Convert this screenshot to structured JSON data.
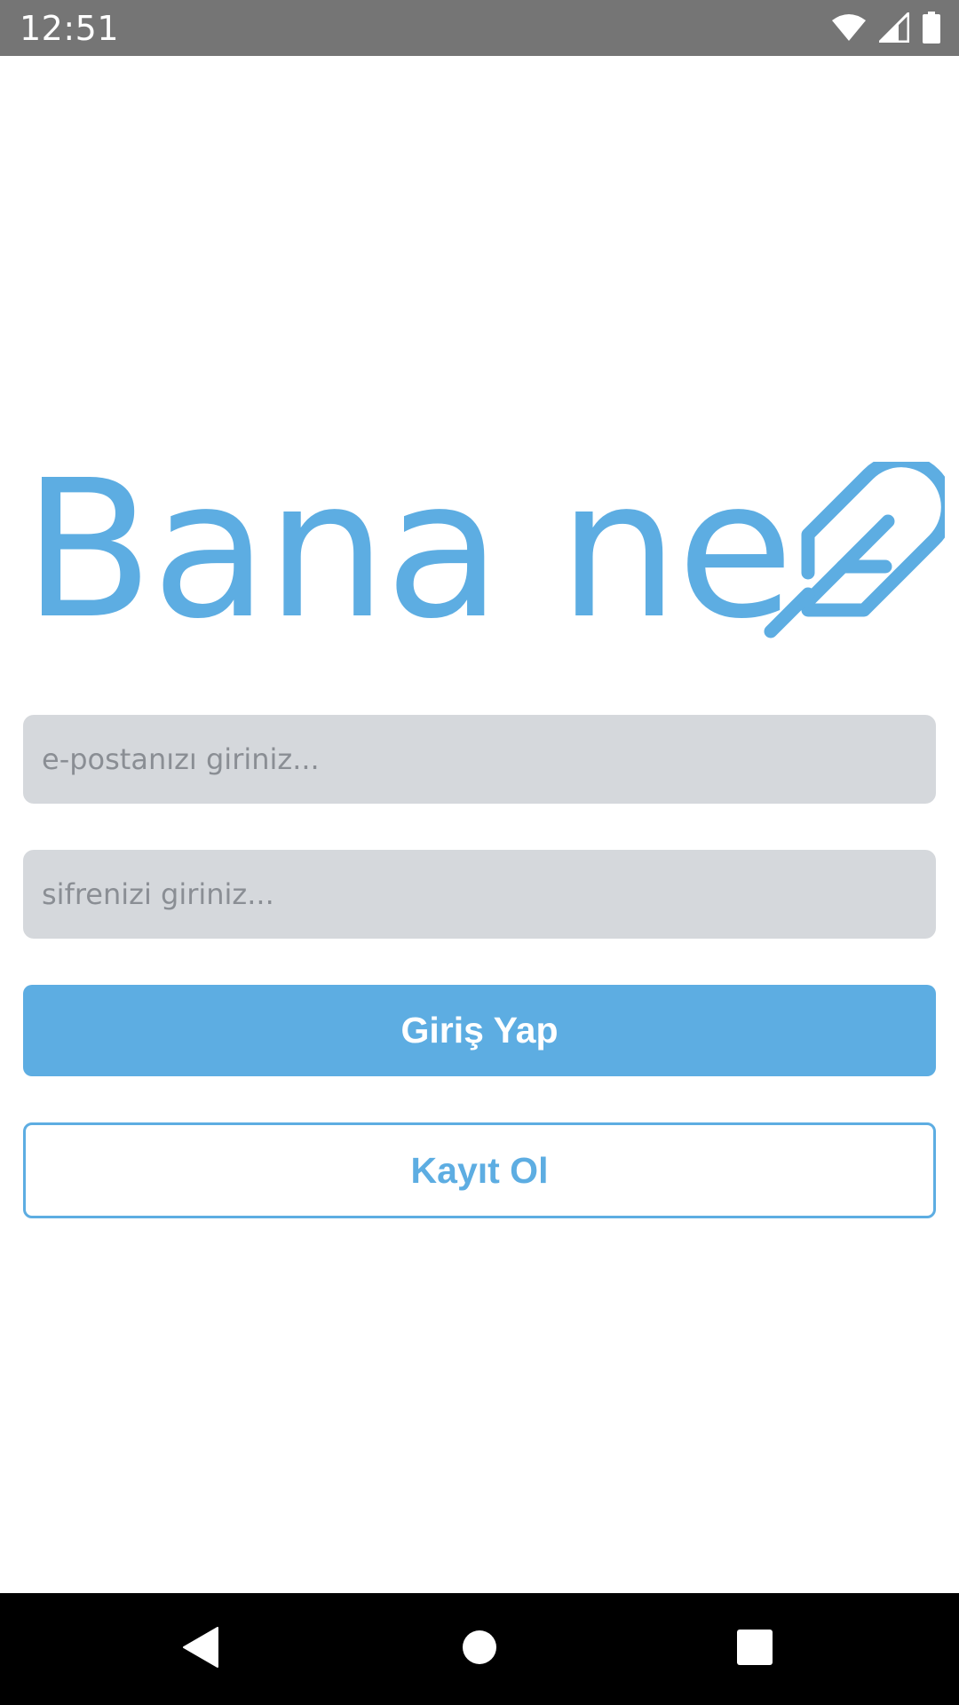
{
  "status_bar": {
    "time": "12:51",
    "icons": [
      "wifi-icon",
      "signal-icon",
      "battery-icon"
    ]
  },
  "logo": {
    "text": "Bana ne",
    "icon": "feather-icon",
    "color": "#5DADE2"
  },
  "form": {
    "email_placeholder": "e-postanızı giriniz...",
    "email_value": "",
    "password_placeholder": "sifrenizi giriniz...",
    "password_value": "",
    "login_label": "Giriş Yap",
    "register_label": "Kayıt Ol"
  },
  "colors": {
    "accent": "#5DADE2",
    "field_background": "#D5D8DC",
    "status_bar": "#757575",
    "nav_bar": "#000000"
  },
  "nav_bar": {
    "icons": [
      "back-icon",
      "home-icon",
      "recents-icon"
    ]
  }
}
